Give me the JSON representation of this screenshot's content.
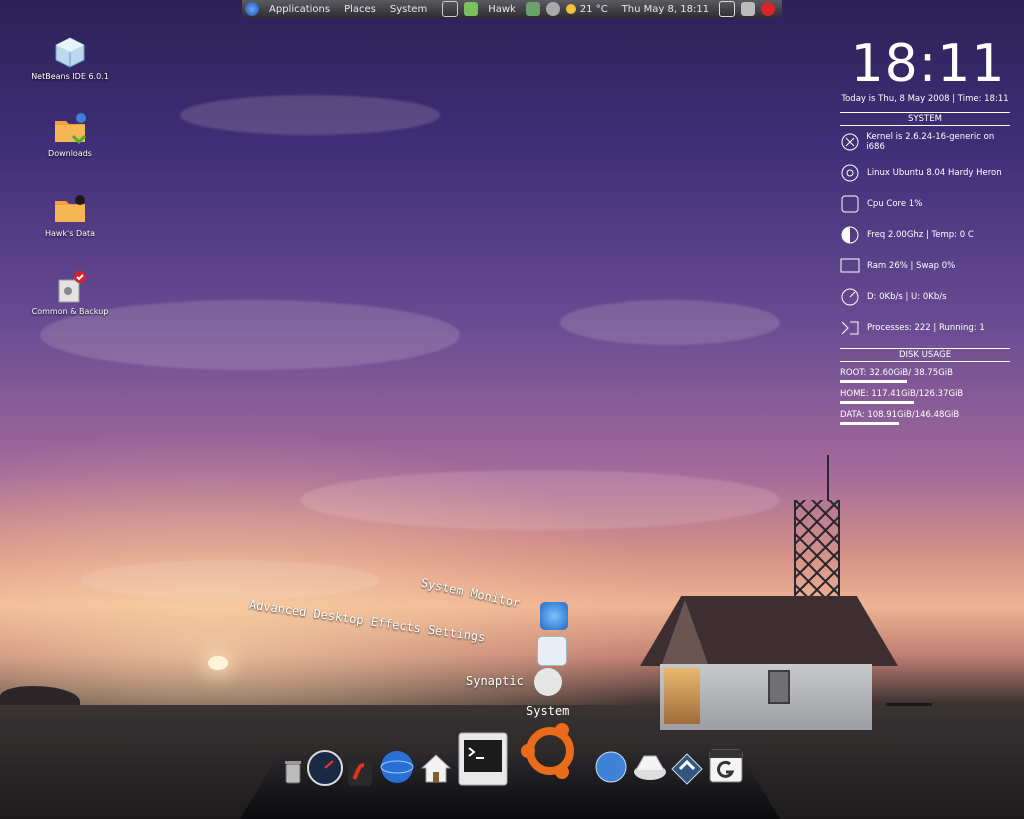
{
  "panel": {
    "menus": [
      "Applications",
      "Places",
      "System"
    ],
    "user": "Hawk",
    "weather": "21 °C",
    "datetime": "Thu May  8, 18:11"
  },
  "desktop_icons": [
    {
      "label": "NetBeans IDE 6.0.1",
      "icon": "cube-icon"
    },
    {
      "label": "Downloads",
      "icon": "folder-icon"
    },
    {
      "label": "Hawk's Data",
      "icon": "folder-icon"
    },
    {
      "label": "Common & Backup",
      "icon": "drive-icon"
    }
  ],
  "conky": {
    "clock": "18:11",
    "date_line": "Today is Thu, 8 May 2008   |  Time: 18:11",
    "system_title": "SYSTEM",
    "system_rows": [
      "Kernel is 2.6.24-16-generic on i686",
      "Linux Ubuntu 8.04 Hardy Heron",
      "Cpu Core   1%",
      "Freq 2.00Ghz | Temp:    0 C",
      "Ram  26%  |  Swap   0%",
      "D:    0Kb/s   |  U:    0Kb/s",
      "Processes:  222 | Running:  1"
    ],
    "disk_title": "DISK USAGE",
    "disks": [
      {
        "text": "ROOT:  32.60GiB/ 38.75GiB",
        "fill": 0.84
      },
      {
        "text": "HOME:  117.41GiB/126.37GiB",
        "fill": 0.93
      },
      {
        "text": "DATA:  108.91GiB/146.48GiB",
        "fill": 0.74
      }
    ]
  },
  "stack_menu": {
    "title": "System",
    "items": [
      "System Monitor",
      "Advanced Desktop Effects Settings",
      "Synaptic"
    ]
  },
  "dock": {
    "items": [
      "trash-icon",
      "clock-icon",
      "flash-icon",
      "globe-icon",
      "home-icon",
      "terminal-icon",
      "ubuntu-icon",
      "network-globe-icon",
      "disk-cleaner-icon",
      "update-manager-icon",
      "gimp-icon"
    ]
  }
}
